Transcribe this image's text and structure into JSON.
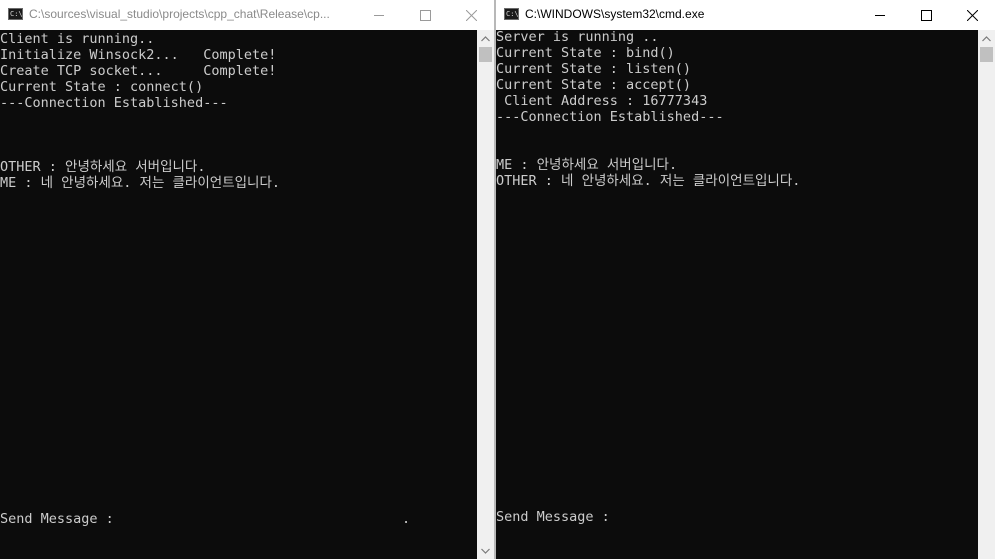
{
  "windows": {
    "client": {
      "title": "C:\\sources\\visual_studio\\projects\\cpp_chat\\Release\\cp...",
      "icon": "cmd-icon",
      "lines": [
        "Client is running..",
        "Initialize Winsock2...   Complete!",
        "Create TCP socket...     Complete!",
        "Current State : connect()",
        "---Connection Established---",
        "OTHER : 안녕하세요 서버입니다.",
        "ME : 네 안녕하세요. 저는 클라이언트입니다."
      ],
      "prompt": "Send Message :",
      "input_value": "."
    },
    "server": {
      "title": "C:\\WINDOWS\\system32\\cmd.exe",
      "icon": "cmd-icon",
      "lines": [
        "Server is running ..",
        "Current State : bind()",
        "Current State : listen()",
        "Current State : accept()",
        " Client Address : 16777343",
        "---Connection Established---",
        "ME : 안녕하세요 서버입니다.",
        "OTHER : 네 안녕하세요. 저는 클라이언트입니다."
      ],
      "prompt": "Send Message :",
      "input_value": ""
    }
  },
  "icon_glyph": "C:\\",
  "colors": {
    "console_bg": "#0c0c0c",
    "console_text": "#cccccc",
    "titlebar_bg": "#ffffff",
    "scrollbar_bg": "#f0f0f0",
    "scrollbar_thumb": "#c0c0c0"
  }
}
